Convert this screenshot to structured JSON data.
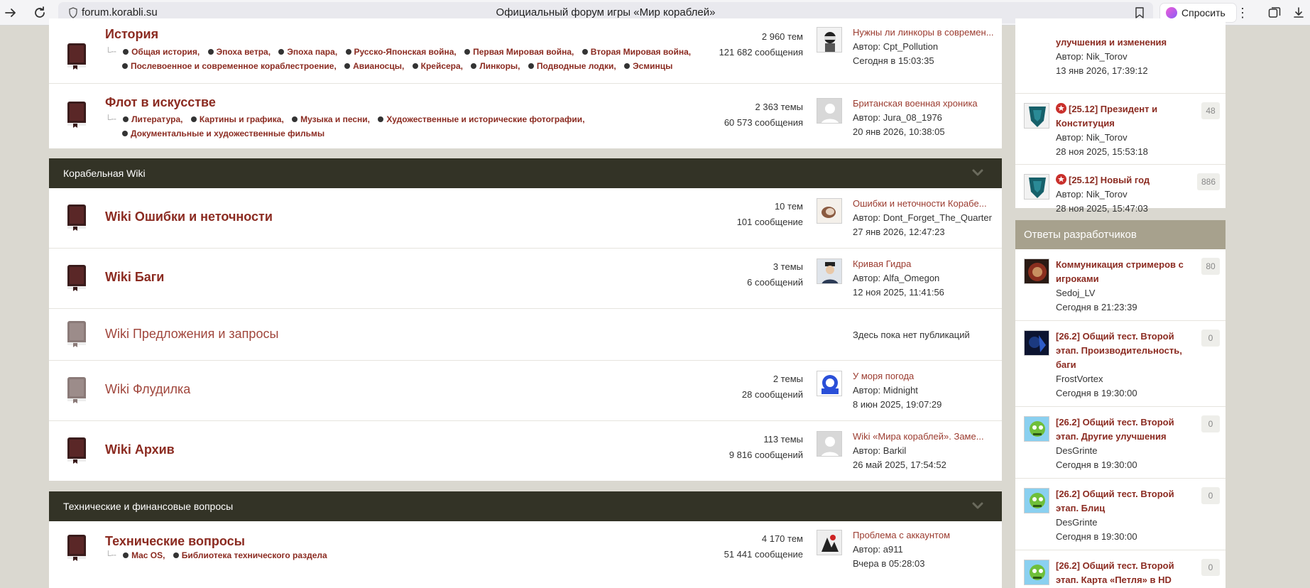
{
  "browser": {
    "url": "forum.korabli.su",
    "page_title": "Официальный форум игры «Мир кораблей»",
    "ask_label": "Спросить",
    "menu_glyph": "⋮"
  },
  "categories": {
    "wiki": {
      "title": "Корабельная Wiki"
    },
    "tech": {
      "title": "Технические и финансовые вопросы"
    }
  },
  "forums": {
    "history": {
      "title": "История",
      "subforums_line1": [
        "Общая история,",
        "Эпоха ветра,",
        "Эпоха пара,",
        "Русско-Японская война,",
        "Первая Мировая война,",
        "Вторая Мировая война,"
      ],
      "subforums_line2": [
        "Послевоенное и современное кораблестроение,",
        "Авианосцы,",
        "Крейсера,",
        "Линкоры,",
        "Подводные лодки,",
        "Эсминцы"
      ],
      "topics": "2 960 тем",
      "posts": "121 682 сообщения",
      "last_title": "Нужны ли линкоры в современ...",
      "last_author": "Автор: Cpt_Pollution",
      "last_date": "Сегодня в 15:03:35"
    },
    "art": {
      "title": "Флот в искусстве",
      "subforums_line1": [
        "Литература,",
        "Картины и графика,",
        "Музыка и песни,",
        "Художественные и исторические фотографии,"
      ],
      "subforums_line2": [
        "Документальные и художественные фильмы"
      ],
      "topics": "2 363 темы",
      "posts": "60 573 сообщения",
      "last_title": "Британская военная хроника",
      "last_author": "Автор: Jura_08_1976",
      "last_date": "20 янв 2026, 10:38:05"
    },
    "wiki_errors": {
      "title": "Wiki Ошибки и неточности",
      "topics": "10 тем",
      "posts": "101 сообщение",
      "last_title": "Ошибки и неточности Корабе...",
      "last_author": "Автор: Dont_Forget_The_Quarter",
      "last_date": "27 янв 2026, 12:47:23"
    },
    "wiki_bugs": {
      "title": "Wiki Баги",
      "topics": "3 темы",
      "posts": "6 сообщений",
      "last_title": "Кривая Гидра",
      "last_author": "Автор: Alfa_Omegon",
      "last_date": "12 ноя 2025, 11:41:56"
    },
    "wiki_suggest": {
      "title": "Wiki Предложения и запросы",
      "no_posts": "Здесь пока нет публикаций"
    },
    "wiki_flood": {
      "title": "Wiki Флудилка",
      "topics": "2 темы",
      "posts": "28 сообщений",
      "last_title": "У моря погода",
      "last_author": "Автор: Midnight",
      "last_date": "8 июн 2025, 19:07:29"
    },
    "wiki_archive": {
      "title": "Wiki Архив",
      "topics": "113 темы",
      "posts": "9 816 сообщений",
      "last_title": "Wiki «Мира кораблей». Заме...",
      "last_author": "Автор: Barkil",
      "last_date": "26 май 2025, 17:54:52"
    },
    "tech_questions": {
      "title": "Технические вопросы",
      "subforums_line1": [
        "Mac OS,",
        "Библиотека технического раздела"
      ],
      "topics": "4 170 тем",
      "posts": "51 441 сообщение",
      "last_title": "Проблема с аккаунтом",
      "last_author": "Автор: a911",
      "last_date": "Вчера в 05:28:03"
    }
  },
  "sidebar": {
    "news": [
      {
        "title": "улучшения и изменения",
        "author": "Автор: Nik_Torov",
        "date": "13 янв 2026, 17:39:12"
      },
      {
        "title": "[25.12] Президент и Конституция",
        "author": "Автор: Nik_Torov",
        "date": "28 ноя 2025, 15:53:18",
        "count": "48"
      },
      {
        "title": "[25.12] Новый год",
        "author": "Автор: Nik_Torov",
        "date": "28 ноя 2025, 15:47:03",
        "count": "886"
      }
    ],
    "dev_answers": {
      "title": "Ответы разработчиков",
      "items": [
        {
          "title": "Коммуникация стримеров с игроками",
          "author": "Sedoj_LV",
          "date": "Сегодня в 21:23:39",
          "count": "80"
        },
        {
          "title": "[26.2] Общий тест. Второй этап. Производительность, баги",
          "author": "FrostVortex",
          "date": "Сегодня в 19:30:00",
          "count": "0"
        },
        {
          "title": "[26.2] Общий тест. Второй этап. Другие улучшения",
          "author": "DesGrinte",
          "date": "Сегодня в 19:30:00",
          "count": "0"
        },
        {
          "title": "[26.2] Общий тест. Второй этап. Блиц",
          "author": "DesGrinte",
          "date": "Сегодня в 19:30:00",
          "count": "0"
        },
        {
          "title": "[26.2] Общий тест. Второй этап. Карта «Петля» в HD",
          "count": "0"
        }
      ]
    }
  },
  "colors": {
    "accent": "#8b2b21",
    "category_header": "#333326",
    "side_header": "#a7a18d",
    "background": "#dad8d0"
  }
}
